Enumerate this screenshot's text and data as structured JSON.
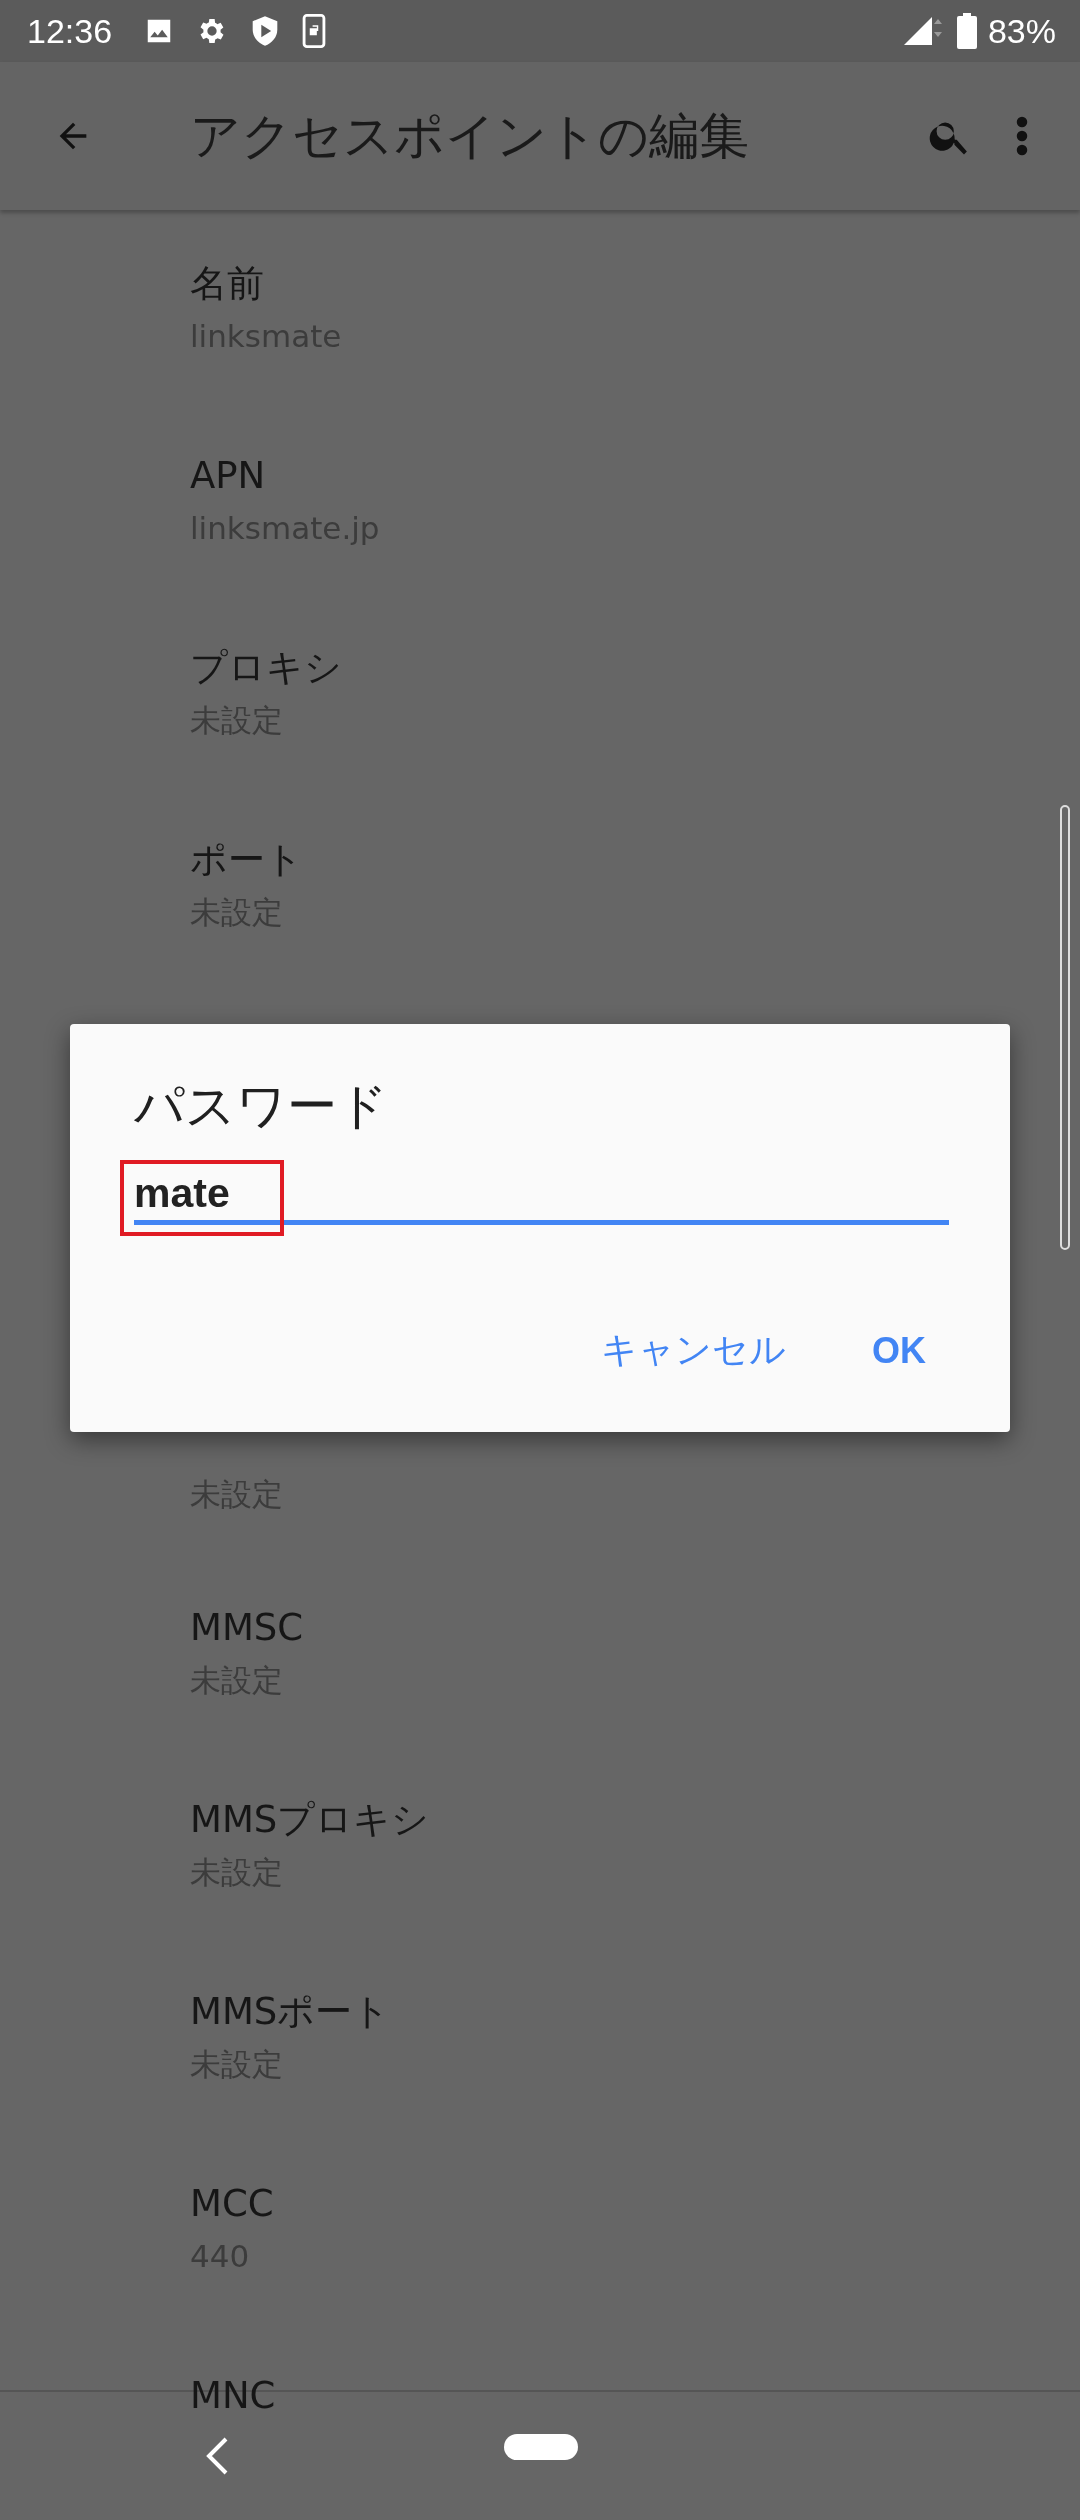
{
  "status_bar": {
    "time": "12:36",
    "battery": "83%"
  },
  "app_bar": {
    "title": "アクセスポイントの編集"
  },
  "list_above": [
    {
      "title": "名前",
      "value": "linksmate"
    },
    {
      "title": "APN",
      "value": "linksmate.jp"
    },
    {
      "title": "プロキシ",
      "value": "未設定"
    },
    {
      "title": "ポート",
      "value": "未設定"
    }
  ],
  "list_below": [
    {
      "value": "未設定"
    },
    {
      "title": "MMSC",
      "value": "未設定"
    },
    {
      "title": "MMSプロキシ",
      "value": "未設定"
    },
    {
      "title": "MMSポート",
      "value": "未設定"
    },
    {
      "title": "MCC",
      "value": "440"
    },
    {
      "title": "MNC"
    }
  ],
  "dialog": {
    "title": "パスワード",
    "value": "mate",
    "highlighted": true,
    "buttons": [
      "キャンセル",
      "OK"
    ]
  }
}
